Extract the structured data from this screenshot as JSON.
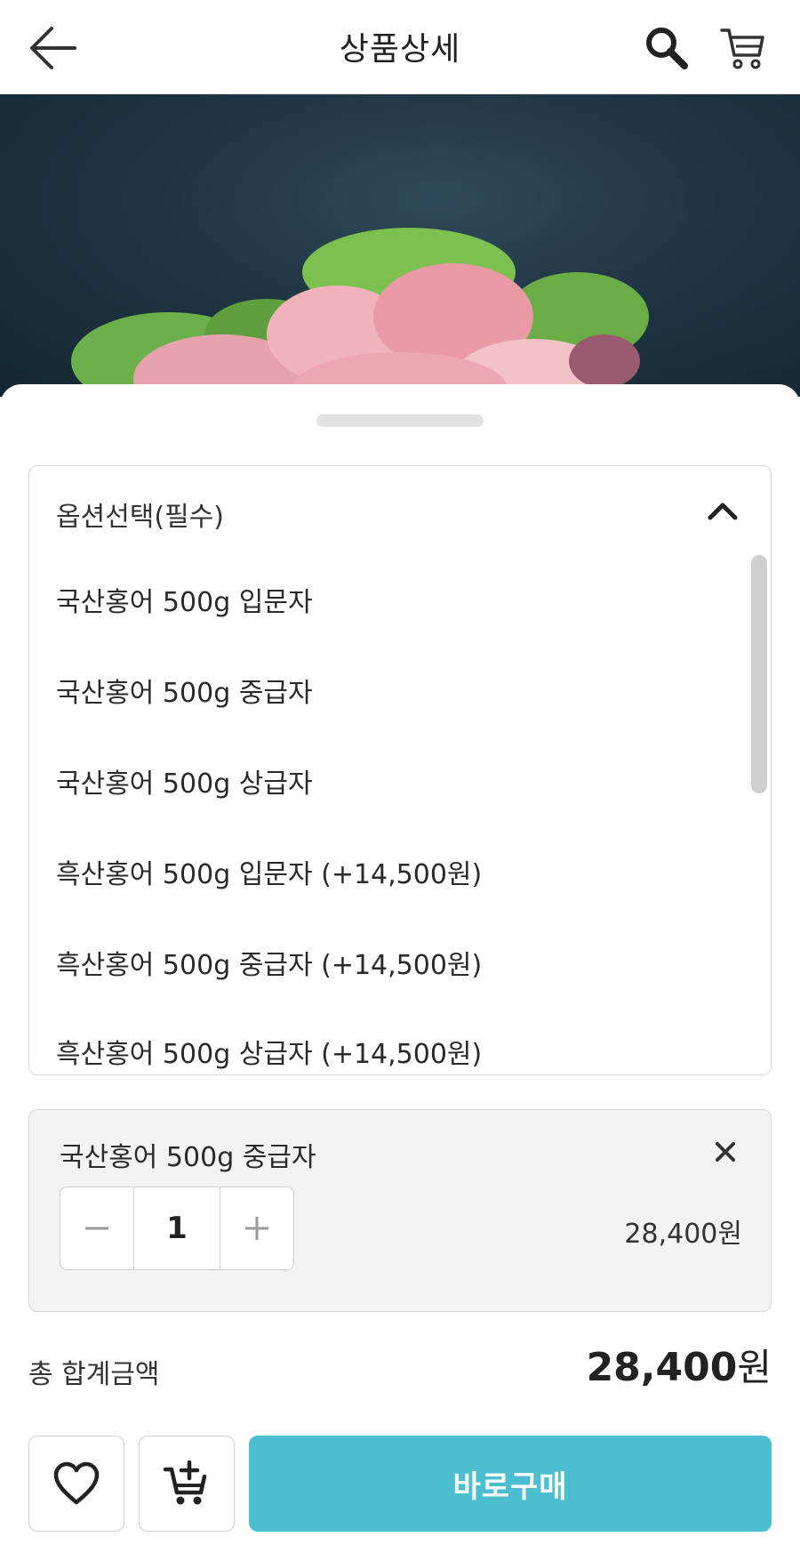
{
  "header": {
    "title": "상품상세",
    "icons": {
      "back": "arrow-left-icon",
      "search": "search-icon",
      "cart": "cart-icon"
    }
  },
  "option_select": {
    "label": "옵션선택(필수)",
    "expanded": true,
    "options": [
      "국산홍어 500g 입문자",
      "국산홍어 500g 중급자",
      "국산홍어 500g 상급자",
      "흑산홍어 500g 입문자 (+14,500원)",
      "흑산홍어 500g 중급자 (+14,500원)",
      "흑산홍어 500g 상급자 (+14,500원)"
    ]
  },
  "selected_item": {
    "name": "국산홍어 500g 중급자",
    "quantity": "1",
    "price": "28,400원"
  },
  "total": {
    "label": "총 합계금액",
    "amount": "28,400",
    "unit": "원"
  },
  "actions": {
    "buy_label": "바로구매",
    "wish_icon": "heart-icon",
    "addcart_icon": "cart-plus-icon"
  },
  "colors": {
    "accent": "#4bbfcf",
    "card_bg": "#f3f3f3",
    "border": "#d8d8d8"
  }
}
